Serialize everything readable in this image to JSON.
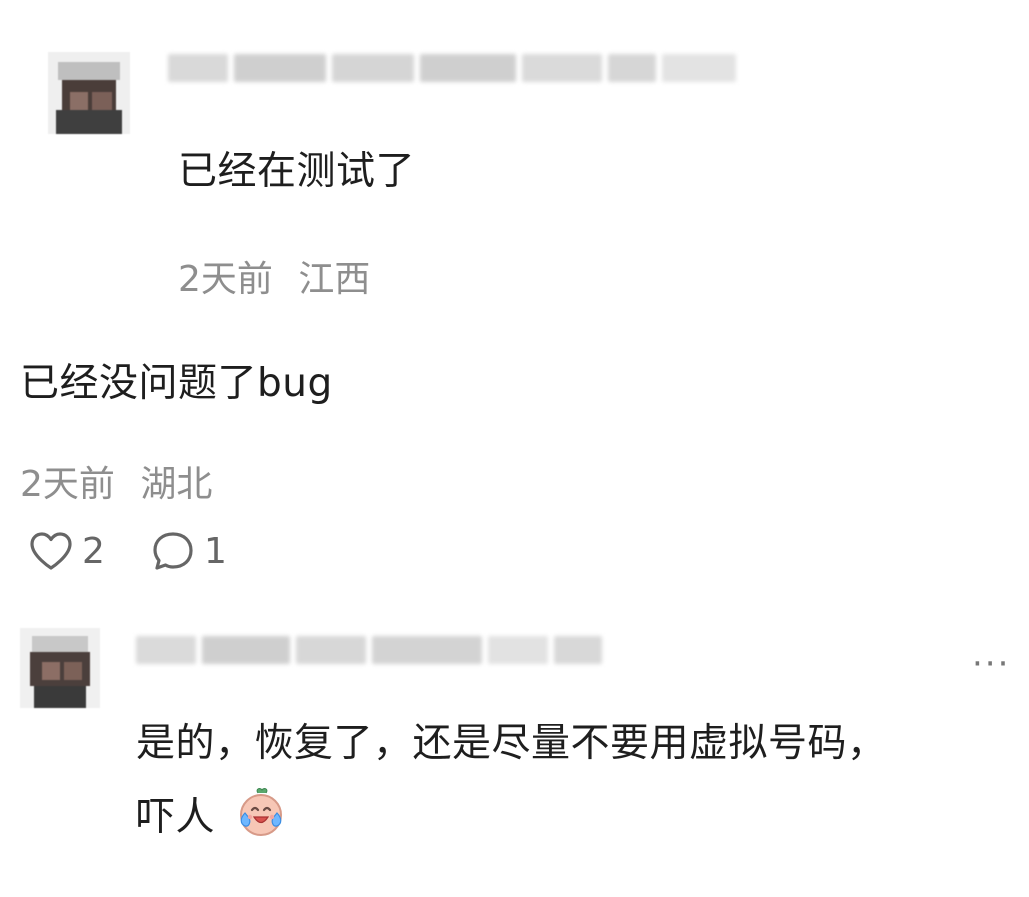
{
  "comments": [
    {
      "body": "已经在测试了",
      "time": "2天前",
      "location": "江西"
    },
    {
      "body": "已经没问题了bug",
      "time": "2天前",
      "location": "湖北",
      "likes": "2",
      "replies": "1"
    },
    {
      "body_line1": "是的，恢复了，还是尽量不要用虚拟号码，",
      "body_line2": "吓人",
      "more": "···"
    }
  ],
  "icons": {
    "like": "heart-outline-icon",
    "reply": "comment-bubble-icon",
    "more": "more-dots-icon",
    "emoji": "crying-laughing-face-icon"
  },
  "colors": {
    "text": "#1e1e1e",
    "meta": "#8e8e8e",
    "icon": "#666666",
    "background": "#ffffff"
  }
}
